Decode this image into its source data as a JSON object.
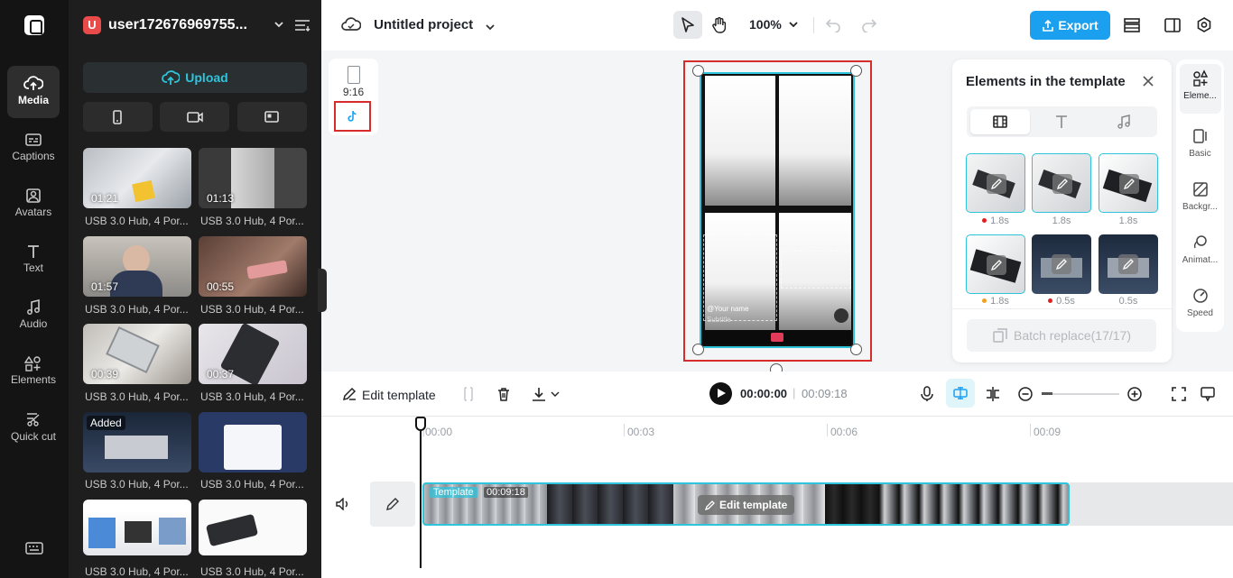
{
  "rail": {
    "items": [
      {
        "label": "Media",
        "icon": "cloud-media-icon"
      },
      {
        "label": "Captions",
        "icon": "captions-icon"
      },
      {
        "label": "Avatars",
        "icon": "avatar-icon"
      },
      {
        "label": "Text",
        "icon": "text-icon"
      },
      {
        "label": "Audio",
        "icon": "music-note-icon"
      },
      {
        "label": "Elements",
        "icon": "elements-icon"
      },
      {
        "label": "Quick cut",
        "icon": "scissors-icon"
      }
    ]
  },
  "media_panel": {
    "user_initial": "U",
    "user_name": "user172676969755...",
    "upload_label": "Upload",
    "device_buttons": [
      "phone-icon",
      "camera-icon",
      "screen-record-icon"
    ],
    "items": [
      {
        "duration": "01:21",
        "caption": "USB 3.0 Hub, 4 Por...",
        "added": ""
      },
      {
        "duration": "01:13",
        "caption": "USB 3.0 Hub, 4 Por...",
        "added": ""
      },
      {
        "duration": "01:57",
        "caption": "USB 3.0 Hub, 4 Por...",
        "added": ""
      },
      {
        "duration": "00:55",
        "caption": "USB 3.0 Hub, 4 Por...",
        "added": ""
      },
      {
        "duration": "00:39",
        "caption": "USB 3.0 Hub, 4 Por...",
        "added": ""
      },
      {
        "duration": "00:37",
        "caption": "USB 3.0 Hub, 4 Por...",
        "added": ""
      },
      {
        "duration": "",
        "caption": "USB 3.0 Hub, 4 Por...",
        "added": "Added"
      },
      {
        "duration": "",
        "caption": "USB 3.0 Hub, 4 Por...",
        "added": ""
      },
      {
        "duration": "",
        "caption": "USB 3.0 Hub, 4 Por...",
        "added": ""
      },
      {
        "duration": "",
        "caption": "USB 3.0 Hub, 4 Por...",
        "added": ""
      }
    ]
  },
  "header": {
    "project_title": "Untitled project",
    "zoom": "100%",
    "export_label": "Export"
  },
  "ratio": {
    "label": "9:16"
  },
  "canvas": {
    "text_line1": "@Your name",
    "text_line2": "Subtitle"
  },
  "elements_panel": {
    "title": "Elements in the template",
    "tiles": [
      {
        "duration": "1.8s",
        "dot": "#e02020"
      },
      {
        "duration": "1.8s",
        "dot": ""
      },
      {
        "duration": "1.8s",
        "dot": ""
      },
      {
        "duration": "1.8s",
        "dot": "#f0a020"
      },
      {
        "duration": "0.5s",
        "dot": "#e02020"
      },
      {
        "duration": "0.5s",
        "dot": ""
      }
    ],
    "batch_label": "Batch replace(17/17)"
  },
  "right_rail": {
    "items": [
      "Eleme...",
      "Basic",
      "Backgr...",
      "Animat...",
      "Speed"
    ]
  },
  "toolbar": {
    "edit_template": "Edit template",
    "current_time": "00:00:00",
    "separator": "|",
    "total_time": "00:09:18"
  },
  "timeline": {
    "ticks": [
      "00:00",
      "00:03",
      "00:06",
      "00:09"
    ],
    "track_label": "Template",
    "track_duration": "00:09:18",
    "edit_template_btn": "Edit template"
  },
  "colors": {
    "accent": "#2ec4db",
    "export": "#1ba0f0",
    "highlight": "#d62c2c"
  }
}
